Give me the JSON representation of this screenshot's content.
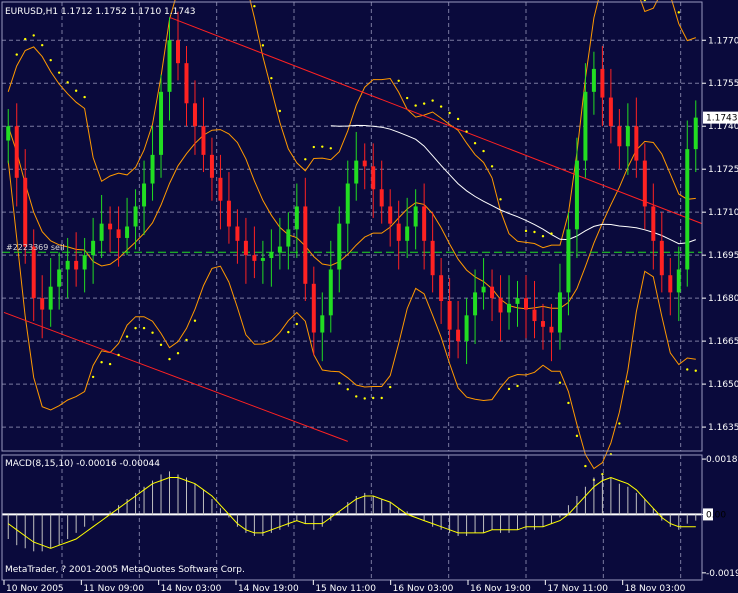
{
  "window": {
    "symbol_header": "EURUSD,H1  1.1712 1.1752 1.1710 1.1743",
    "trendline_label": "#2223369 sell",
    "macd_header": "MACD(8,15,10) -0.00016 -0.00044",
    "copyright": "MetaTrader, ? 2001-2005 MetaQuotes Software Corp."
  },
  "colors": {
    "background": "#0a0a3c",
    "grid": "#7a7aa0",
    "bull_candle": "#22dd22",
    "bear_candle": "#ff2222",
    "bollinger": "#ff9900",
    "parabolic_sar": "#ffff00",
    "moving_average": "#ffffff",
    "trendline": "#ff2222",
    "order_line": "#22dd22",
    "macd_histogram": "#c0c0c0",
    "macd_signal": "#ffff00",
    "current_price_box": "#ffffff"
  },
  "chart_data": [
    {
      "type": "candlestick",
      "symbol": "EURUSD",
      "timeframe": "H1",
      "ohlc_header": {
        "open": 1.1712,
        "high": 1.1752,
        "low": 1.171,
        "close": 1.1743
      },
      "current_price": 1.1743,
      "current_price_label": "1.1743",
      "order_line_price": 1.1696,
      "y_range": [
        1.1627,
        1.1783
      ],
      "y_tick_values": [
        1.1635,
        1.165,
        1.1665,
        1.168,
        1.1695,
        1.171,
        1.1725,
        1.174,
        1.1755,
        1.177
      ],
      "y_tick_labels": [
        "1.1635",
        "1.1650",
        "1.1665",
        "1.1680",
        "1.1695",
        "1.1710",
        "1.1725",
        "1.1740",
        "1.1755",
        "1.1770"
      ],
      "x_tick_labels": [
        "10 Nov 2005",
        "11 Nov 09:00",
        "14 Nov 03:00",
        "14 Nov 19:00",
        "15 Nov 11:00",
        "16 Nov 03:00",
        "16 Nov 19:00",
        "17 Nov 11:00",
        "18 Nov 03:00"
      ],
      "indicators": [
        "Bollinger Bands",
        "Parabolic SAR",
        "Moving Average"
      ],
      "grid": true,
      "closes": [
        1.174,
        1.1722,
        1.1698,
        1.168,
        1.1676,
        1.1684,
        1.169,
        1.1693,
        1.169,
        1.1695,
        1.17,
        1.1706,
        1.1704,
        1.1701,
        1.1705,
        1.1712,
        1.172,
        1.173,
        1.1752,
        1.177,
        1.1762,
        1.1748,
        1.174,
        1.173,
        1.1722,
        1.1714,
        1.1705,
        1.17,
        1.1695,
        1.1693,
        1.1694,
        1.1696,
        1.1698,
        1.1704,
        1.1712,
        1.1685,
        1.1668,
        1.1674,
        1.169,
        1.1706,
        1.172,
        1.1728,
        1.1726,
        1.1718,
        1.1712,
        1.1706,
        1.17,
        1.1705,
        1.1712,
        1.17,
        1.1688,
        1.1679,
        1.1669,
        1.1665,
        1.1674,
        1.1682,
        1.1684,
        1.168,
        1.1675,
        1.1678,
        1.168,
        1.1676,
        1.1672,
        1.167,
        1.1668,
        1.1682,
        1.1704,
        1.1728,
        1.1752,
        1.176,
        1.175,
        1.174,
        1.1733,
        1.174,
        1.1728,
        1.1712,
        1.17,
        1.1688,
        1.1682,
        1.169,
        1.1732,
        1.1743
      ]
    },
    {
      "type": "bar",
      "name": "MACD(8,15,10)",
      "macd_value": -0.00016,
      "signal_value": -0.00044,
      "y_range": [
        -0.0021,
        0.0019
      ],
      "y_tick_labels": [
        "0.0018",
        "0.00",
        "-0.0019"
      ],
      "histogram": [
        -0.0008,
        -0.001,
        -0.0011,
        -0.0012,
        -0.0012,
        -0.0011,
        -0.001,
        -0.0008,
        -0.0006,
        -0.0004,
        -0.0002,
        0.0,
        0.0001,
        0.0003,
        0.0005,
        0.0007,
        0.0009,
        0.0011,
        0.0013,
        0.0014,
        0.0013,
        0.0012,
        0.001,
        0.0008,
        0.0005,
        0.0002,
        -0.0001,
        -0.0004,
        -0.0006,
        -0.0007,
        -0.0007,
        -0.0006,
        -0.0005,
        -0.0004,
        -0.0002,
        -0.0003,
        -0.0005,
        -0.0004,
        -0.0002,
        0.0001,
        0.0004,
        0.0006,
        0.0007,
        0.0006,
        0.0005,
        0.0004,
        0.0002,
        0.0001,
        0.0,
        -0.0002,
        -0.0004,
        -0.0005,
        -0.0006,
        -0.0007,
        -0.0007,
        -0.0006,
        -0.0006,
        -0.0005,
        -0.0006,
        -0.0006,
        -0.0005,
        -0.0005,
        -0.0005,
        -0.0004,
        -0.0003,
        -0.0001,
        0.0003,
        0.0006,
        0.0009,
        0.0012,
        0.0013,
        0.0012,
        0.001,
        0.0009,
        0.0007,
        0.0005,
        0.0002,
        -0.0002,
        -0.0004,
        -0.0005,
        -0.0003,
        -0.0002
      ],
      "signal": [
        -0.0003,
        -0.0005,
        -0.0007,
        -0.0009,
        -0.001,
        -0.0011,
        -0.001,
        -0.0009,
        -0.0008,
        -0.0006,
        -0.0004,
        -0.0002,
        0.0,
        0.0002,
        0.0004,
        0.0006,
        0.0008,
        0.001,
        0.0011,
        0.0012,
        0.0012,
        0.0011,
        0.001,
        0.0008,
        0.0006,
        0.0003,
        0.0,
        -0.0003,
        -0.0005,
        -0.0006,
        -0.0006,
        -0.0005,
        -0.0004,
        -0.0003,
        -0.0002,
        -0.0003,
        -0.0003,
        -0.0003,
        -0.0001,
        0.0001,
        0.0003,
        0.0005,
        0.0006,
        0.0006,
        0.0005,
        0.0004,
        0.0002,
        0.0,
        -0.0001,
        -0.0002,
        -0.0003,
        -0.0004,
        -0.0005,
        -0.0006,
        -0.0006,
        -0.0006,
        -0.0006,
        -0.0005,
        -0.0005,
        -0.0005,
        -0.0005,
        -0.0004,
        -0.0004,
        -0.0004,
        -0.0003,
        -0.0002,
        0.0,
        0.0003,
        0.0006,
        0.0009,
        0.0011,
        0.0012,
        0.0011,
        0.001,
        0.0008,
        0.0005,
        0.0002,
        -0.0001,
        -0.0003,
        -0.0004,
        -0.0004,
        -0.0004
      ]
    }
  ]
}
